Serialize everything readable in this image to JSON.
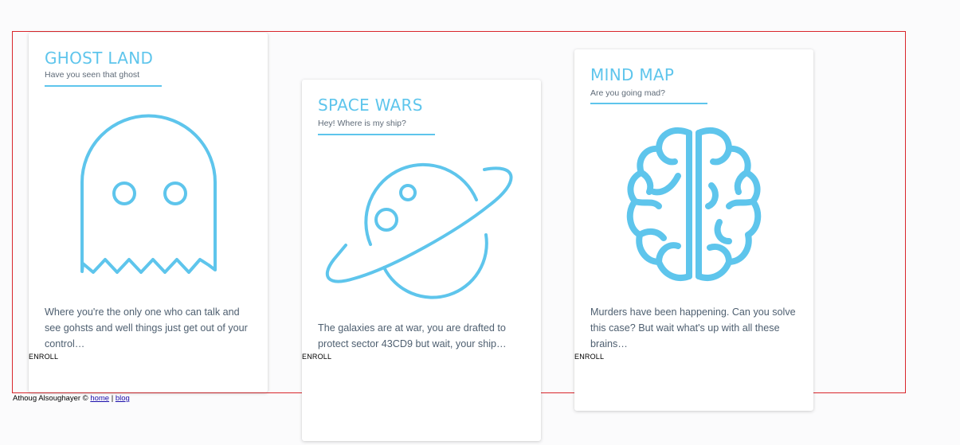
{
  "colors": {
    "accent": "#5ec5ec",
    "text": "#4e5f70",
    "outline": "#d9262c"
  },
  "courses": [
    {
      "title": "GHOST LAND",
      "subtitle": "Have you seen that ghost",
      "icon": "ghost-icon",
      "description": "Where you're the only one who can talk and see gohsts and well things just get out of your control…",
      "action": "ENROLL"
    },
    {
      "title": "SPACE WARS",
      "subtitle": "Hey! Where is my ship?",
      "icon": "planet-icon",
      "description": "The galaxies are at war, you are drafted to protect sector 43CD9 but wait, your ship…",
      "action": "ENROLL"
    },
    {
      "title": "MIND MAP",
      "subtitle": "Are you going mad?",
      "icon": "brain-icon",
      "description": "Murders have been happening. Can you solve this case? But wait what's up with all these brains…",
      "action": "ENROLL"
    }
  ],
  "footer": {
    "author": "Athoug Alsoughayer ©",
    "home_link": "home",
    "separator": "|",
    "blog_link": "blog"
  }
}
